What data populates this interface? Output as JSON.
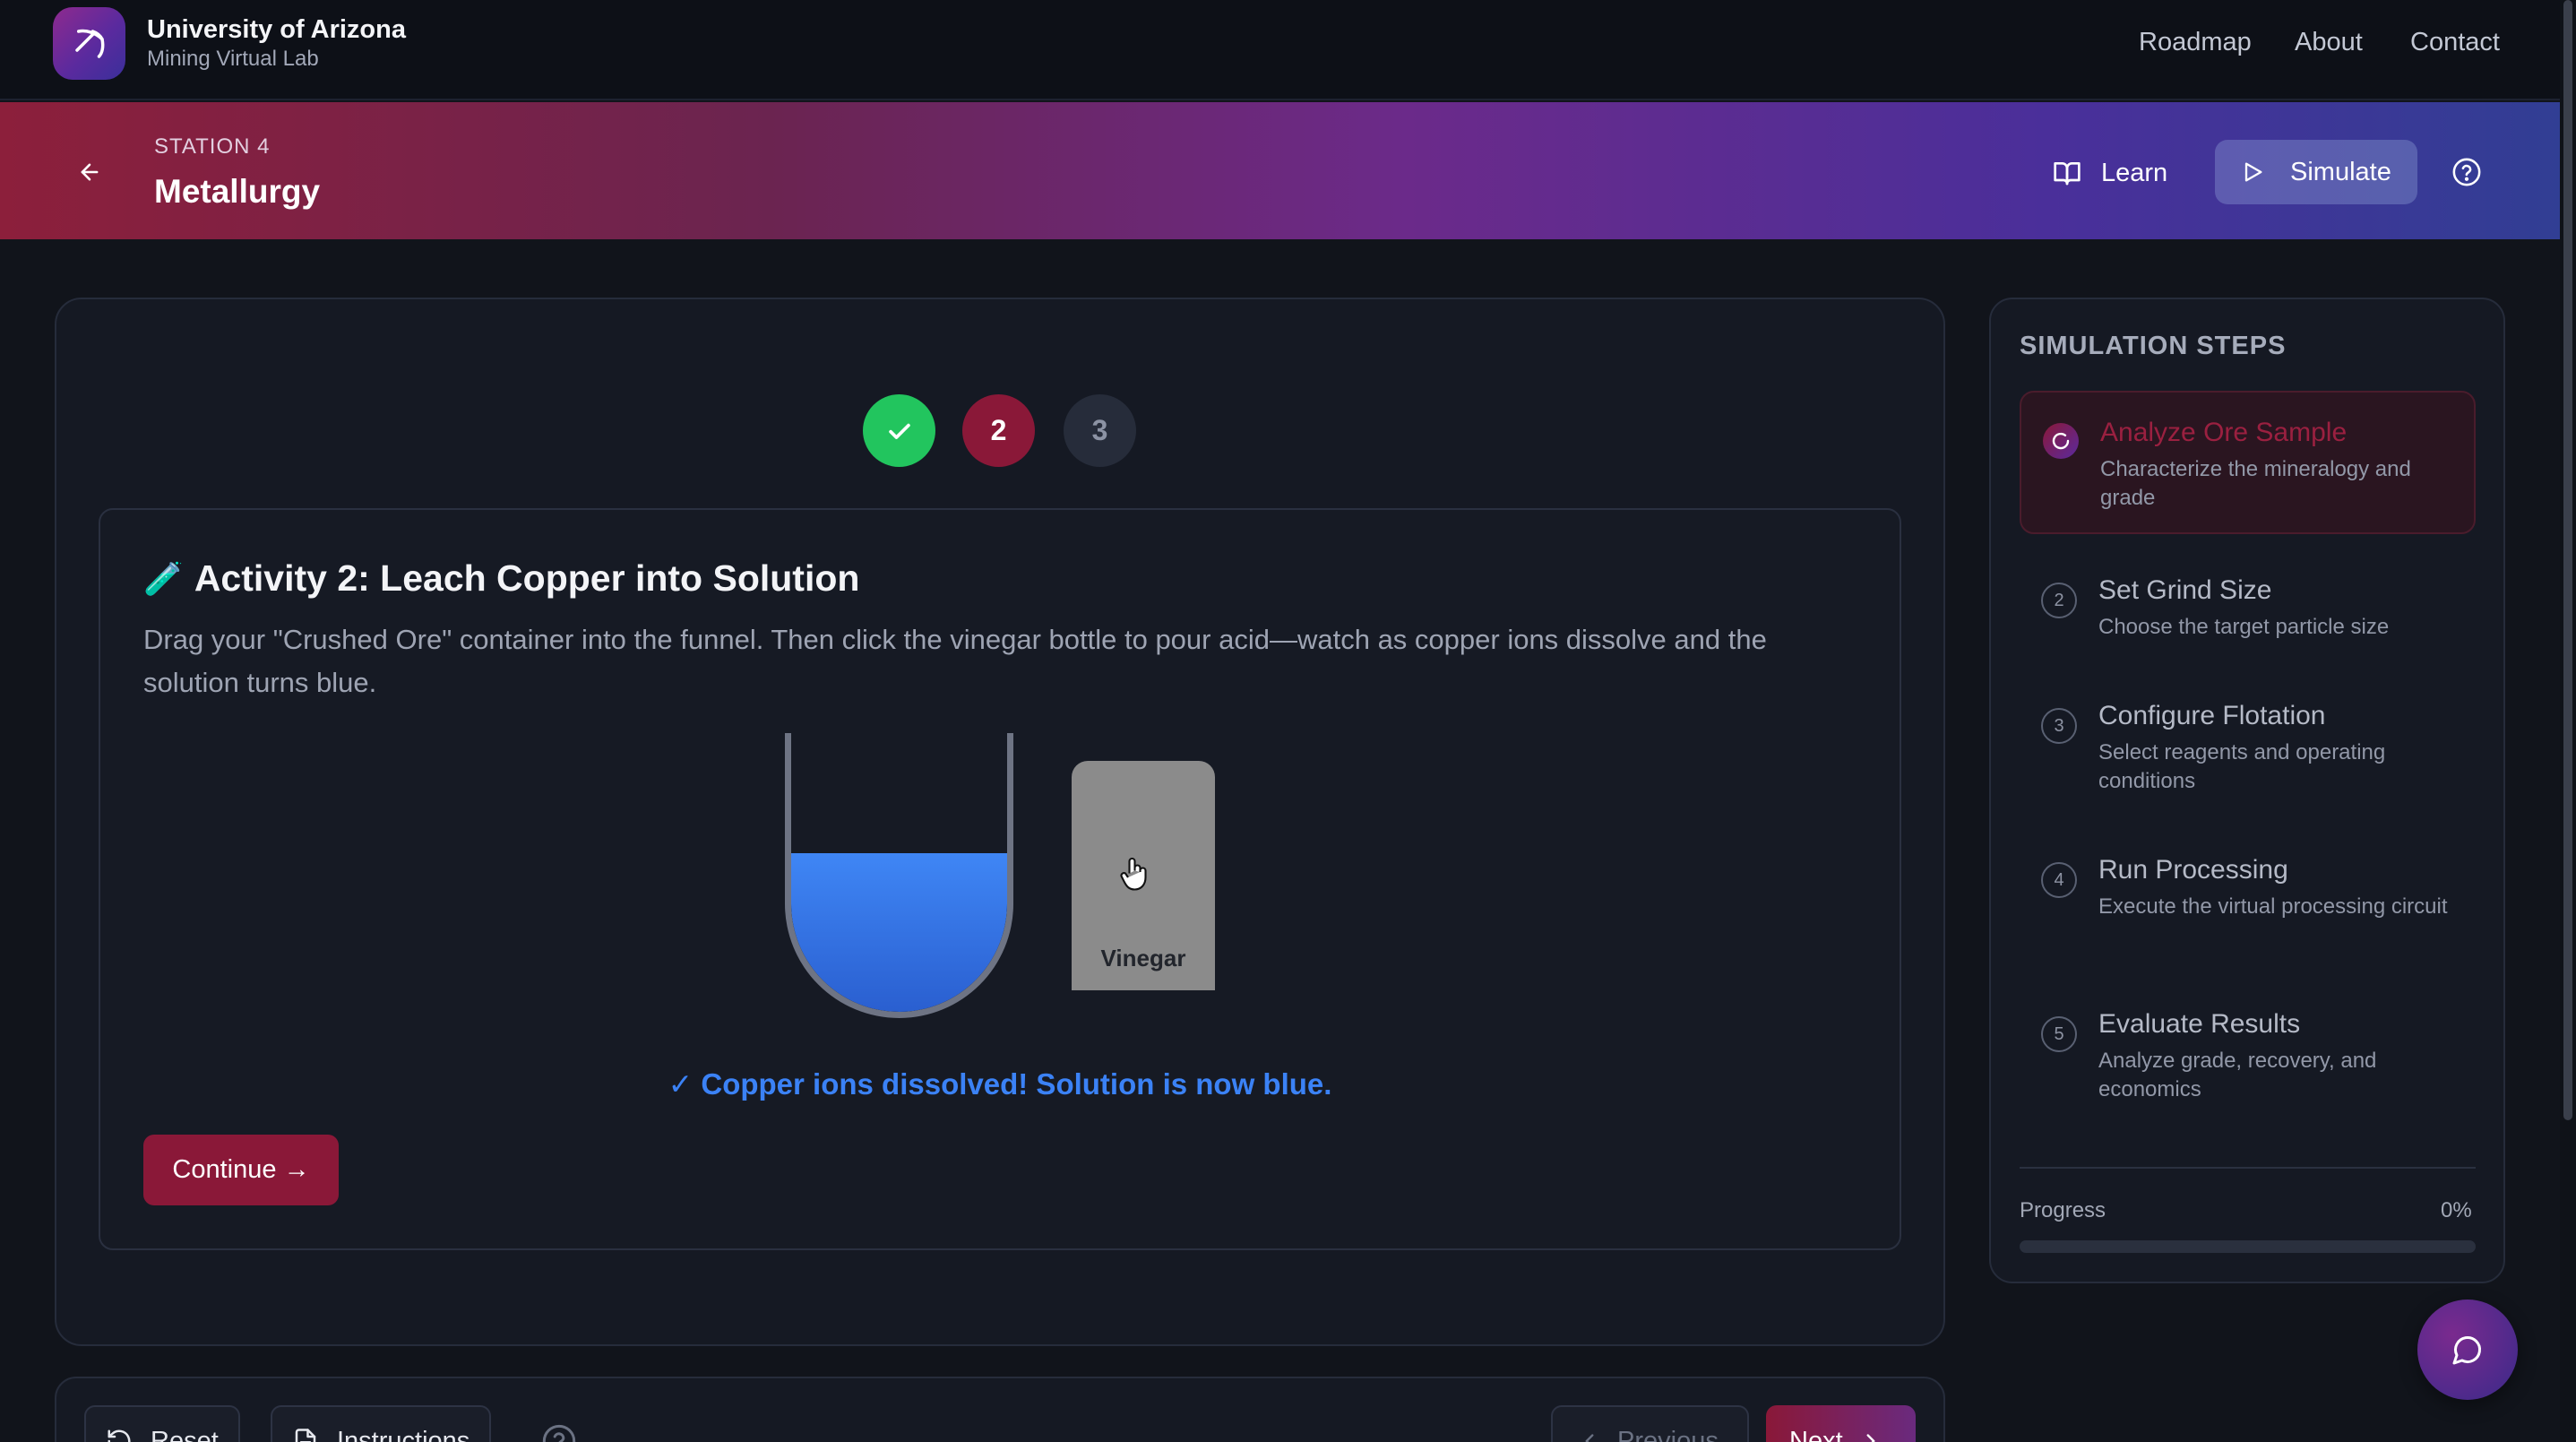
{
  "brand": {
    "title": "University of Arizona",
    "subtitle": "Mining Virtual Lab"
  },
  "nav": {
    "links": [
      {
        "label": "Roadmap",
        "icon": null
      },
      {
        "label": "About",
        "icon": null
      },
      {
        "label": "Contact",
        "icon": null
      }
    ]
  },
  "station": {
    "label": "STATION 4",
    "title": "Metallurgy",
    "learn_label": "Learn",
    "simulate_label": "Simulate"
  },
  "stepper": {
    "steps": [
      {
        "label": "",
        "state": "done",
        "icon": "check-icon"
      },
      {
        "label": "2",
        "state": "active"
      },
      {
        "label": "3",
        "state": "pending"
      }
    ]
  },
  "activity": {
    "emoji": "🧪",
    "title": "Activity 2: Leach Copper into Solution",
    "description": "Drag your \"Crushed Ore\" container into the funnel. Then click the vinegar bottle to pour acid—watch as copper ions dissolve and the solution turns blue.",
    "vinegar_label": "Vinegar",
    "beaker_fill_fraction": 0.57,
    "success_message": "✓ Copper ions dissolved! Solution is now blue.",
    "continue_label": "Continue →"
  },
  "toolbar": {
    "reset_label": "Reset",
    "instructions_label": "Instructions",
    "previous_label": "Previous",
    "next_label": "Next"
  },
  "sidebar": {
    "heading": "SIMULATION STEPS",
    "steps": [
      {
        "num": "",
        "title": "Analyze Ore Sample",
        "desc": "Characterize the mineralogy and grade",
        "active": true
      },
      {
        "num": "2",
        "title": "Set Grind Size",
        "desc": "Choose the target particle size",
        "active": false
      },
      {
        "num": "3",
        "title": "Configure Flotation",
        "desc": "Select reagents and operating conditions",
        "active": false
      },
      {
        "num": "4",
        "title": "Run Processing",
        "desc": "Execute the virtual processing circuit",
        "active": false
      },
      {
        "num": "5",
        "title": "Evaluate Results",
        "desc": "Analyze grade, recovery, and economics",
        "active": false
      }
    ],
    "progress_label": "Progress",
    "progress_value": "0%",
    "progress_fraction": 0
  },
  "colors": {
    "accent": "#8a1838",
    "success": "#22c55e",
    "liquid": "#3b82f6"
  }
}
